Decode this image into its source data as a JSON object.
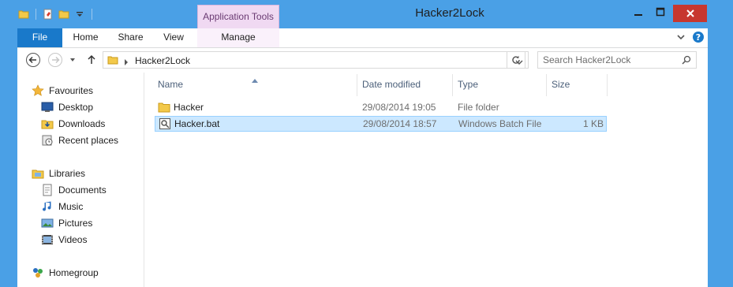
{
  "window": {
    "title": "Hacker2Lock",
    "context_tab_group": "Application Tools"
  },
  "ribbon": {
    "tabs": [
      "File",
      "Home",
      "Share",
      "View",
      "Manage"
    ]
  },
  "address": {
    "path": "Hacker2Lock",
    "search_placeholder": "Search Hacker2Lock"
  },
  "sidebar": {
    "favourites": "Favourites",
    "fav_items": [
      "Desktop",
      "Downloads",
      "Recent places"
    ],
    "libraries": "Libraries",
    "lib_items": [
      "Documents",
      "Music",
      "Pictures",
      "Videos"
    ],
    "homegroup": "Homegroup"
  },
  "columns": {
    "name": "Name",
    "date": "Date modified",
    "type": "Type",
    "size": "Size"
  },
  "files": [
    {
      "name": "Hacker",
      "date": "29/08/2014 19:05",
      "type": "File folder",
      "size": "",
      "icon": "folder-icon"
    },
    {
      "name": "Hacker.bat",
      "date": "29/08/2014 18:57",
      "type": "Windows Batch File",
      "size": "1 KB",
      "icon": "batch-file-icon",
      "selected": true
    }
  ],
  "colors": {
    "titlebar": "#4aa0e6",
    "file_tab": "#1979ca",
    "context_tab": "#f0d9f2",
    "selection": "#cce8ff",
    "close_button": "#c7372f"
  }
}
